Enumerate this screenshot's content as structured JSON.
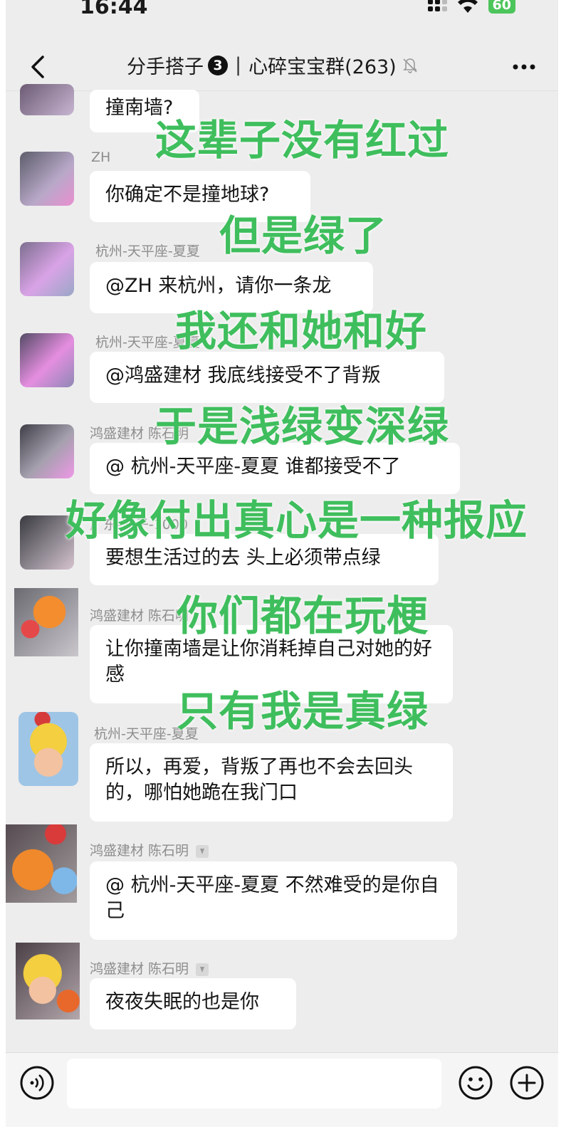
{
  "status_bar": {
    "time": "16:44",
    "battery": "60"
  },
  "nav": {
    "title_prefix": "分手搭子",
    "badge": "3",
    "separator": "|",
    "group_name": "心碎宝宝群(263)"
  },
  "messages": [
    {
      "sender": "",
      "text": "撞南墙?"
    },
    {
      "sender": "ZH",
      "text": "你确定不是撞地球?"
    },
    {
      "sender": "杭州-天平座-夏夏",
      "text": "@ZH 来杭州，请你一条龙"
    },
    {
      "sender": "杭州-天平座-夏夏",
      "text": "@鸿盛建材 我底线接受不了背叛"
    },
    {
      "sender": "鸿盛建材  陈石明",
      "text": "@ 杭州-天平座-夏夏 谁都接受不了"
    },
    {
      "sender": "广东-凉子-1000",
      "text": "要想生活过的去 头上必须带点绿"
    },
    {
      "sender": "鸿盛建材  陈石明",
      "text": "让你撞南墙是让你消耗掉自己对她的好感"
    },
    {
      "sender": "杭州-天平座-夏夏",
      "text": "所以，再爱，背叛了再也不会去回头的，哪怕她跪在我门口"
    },
    {
      "sender": "鸿盛建材  陈石明",
      "text": "@ 杭州-天平座-夏夏 不然难受的是你自己"
    },
    {
      "sender": "鸿盛建材  陈石明",
      "text": "夜夜失眠的也是你"
    }
  ],
  "overlay_lines": [
    "这辈子没有红过",
    "但是绿了",
    "我还和她和好",
    "于是浅绿变深绿",
    "好像付出真心是一种报应",
    "你们都在玩梗",
    "只有我是真绿"
  ],
  "colors": {
    "overlay_green": "#3fbe5d",
    "background": "#ededed",
    "bubble": "#ffffff"
  }
}
